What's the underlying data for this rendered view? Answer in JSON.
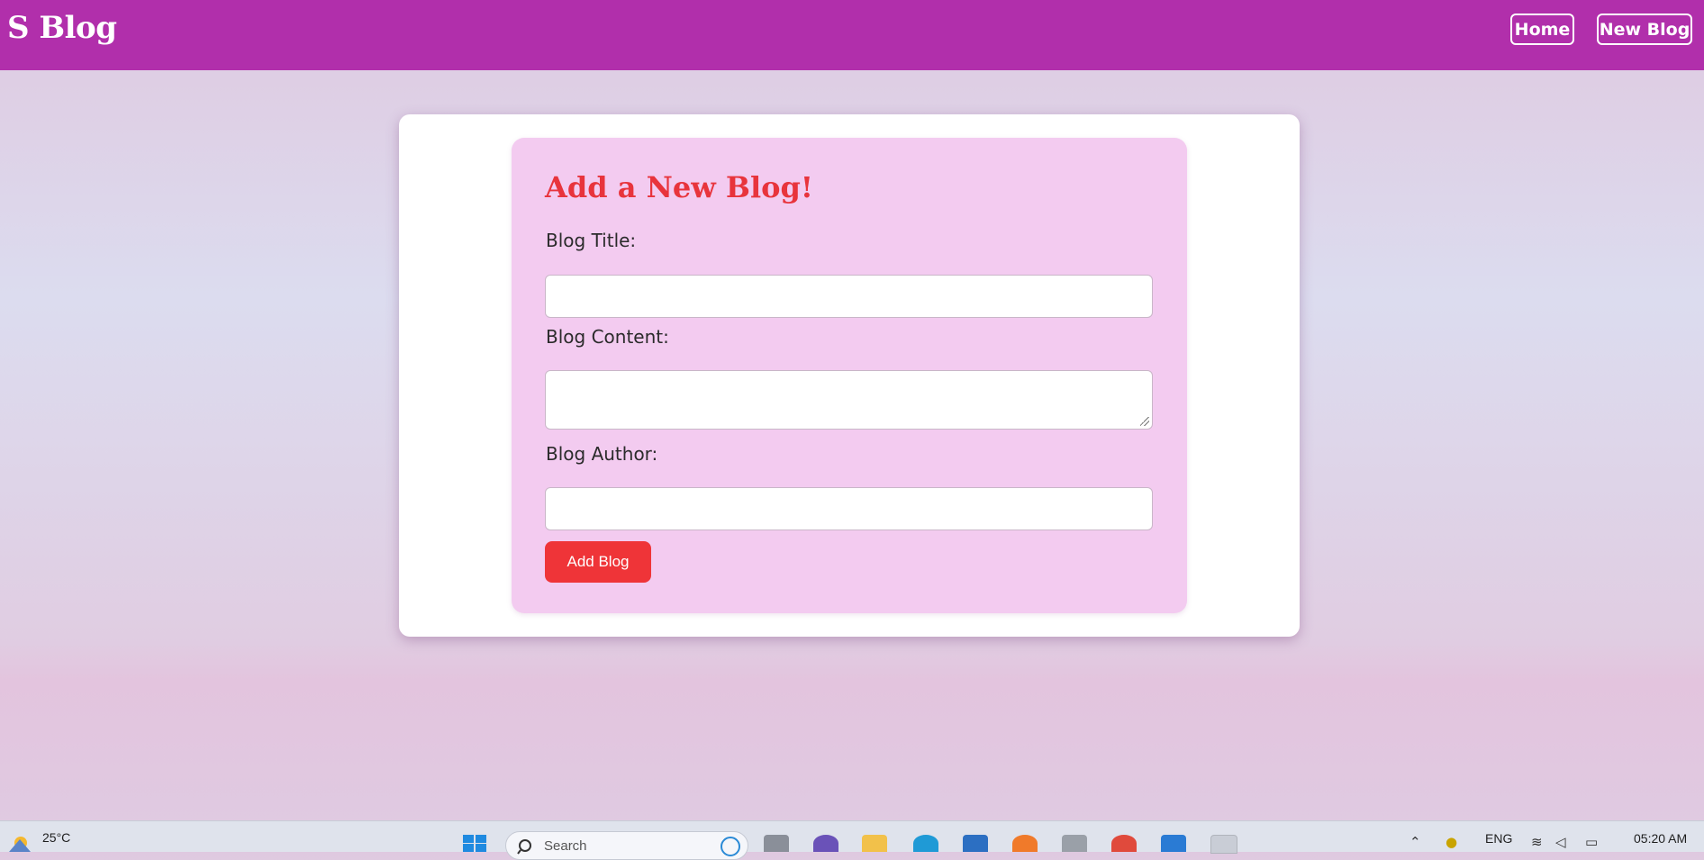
{
  "header": {
    "brand": "S Blog",
    "nav": [
      {
        "label": "Home"
      },
      {
        "label": "New Blog"
      }
    ],
    "color": "#b12fab"
  },
  "form": {
    "title": "Add a New Blog!",
    "fields": {
      "title": {
        "label": "Blog Title:",
        "value": ""
      },
      "content": {
        "label": "Blog Content:",
        "value": ""
      },
      "author": {
        "label": "Blog Author:",
        "value": ""
      }
    },
    "submit_label": "Add Blog",
    "accent": "#ef3438"
  },
  "taskbar": {
    "temperature": "25°C",
    "search_placeholder": "Search",
    "language": "ENG",
    "time": "05:20 AM",
    "apps": [
      "files-app-icon",
      "teams-icon",
      "file-explorer-icon",
      "edge-icon",
      "store-icon",
      "firefox-icon",
      "amazon-icon",
      "chrome-icon",
      "vscode-icon",
      "snipping-tool-icon"
    ]
  }
}
